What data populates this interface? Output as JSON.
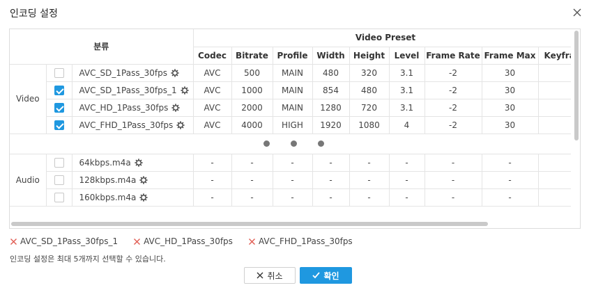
{
  "dialog": {
    "title": "인코딩 설정",
    "close_icon": "close-icon"
  },
  "table": {
    "category_header": "분류",
    "group_header": "Video Preset",
    "columns": [
      "Codec",
      "Bitrate",
      "Profile",
      "Width",
      "Height",
      "Level",
      "Frame Rate",
      "Frame Max",
      "Keyfra"
    ],
    "video": {
      "label": "Video",
      "rows": [
        {
          "name": "AVC_SD_1Pass_30fps",
          "checked": false,
          "values": [
            "AVC",
            "500",
            "MAIN",
            "480",
            "320",
            "3.1",
            "-2",
            "30",
            ""
          ]
        },
        {
          "name": "AVC_SD_1Pass_30fps_1",
          "checked": true,
          "values": [
            "AVC",
            "1000",
            "MAIN",
            "854",
            "480",
            "3.1",
            "-2",
            "30",
            ""
          ]
        },
        {
          "name": "AVC_HD_1Pass_30fps",
          "checked": true,
          "values": [
            "AVC",
            "2000",
            "MAIN",
            "1280",
            "720",
            "3.1",
            "-2",
            "30",
            ""
          ]
        },
        {
          "name": "AVC_FHD_1Pass_30fps",
          "checked": true,
          "values": [
            "AVC",
            "4000",
            "HIGH",
            "1920",
            "1080",
            "4",
            "-2",
            "30",
            ""
          ]
        }
      ]
    },
    "audio": {
      "label": "Audio",
      "rows": [
        {
          "name": "64kbps.m4a",
          "checked": false,
          "values": [
            "-",
            "-",
            "-",
            "-",
            "-",
            "-",
            "-",
            "-",
            ""
          ]
        },
        {
          "name": "128kbps.m4a",
          "checked": false,
          "values": [
            "-",
            "-",
            "-",
            "-",
            "-",
            "-",
            "-",
            "-",
            ""
          ]
        },
        {
          "name": "160kbps.m4a",
          "checked": false,
          "values": [
            "-",
            "-",
            "-",
            "-",
            "-",
            "-",
            "-",
            "-",
            ""
          ]
        }
      ]
    }
  },
  "selected": [
    "AVC_SD_1Pass_30fps_1",
    "AVC_HD_1Pass_30fps",
    "AVC_FHD_1Pass_30fps"
  ],
  "notice": "인코딩 설정은 최대 5개까지 선택할 수 있습니다.",
  "buttons": {
    "cancel_label": "취소",
    "ok_label": "확인"
  },
  "colors": {
    "accent": "#1f98e0",
    "remove_x": "#e05a50"
  }
}
